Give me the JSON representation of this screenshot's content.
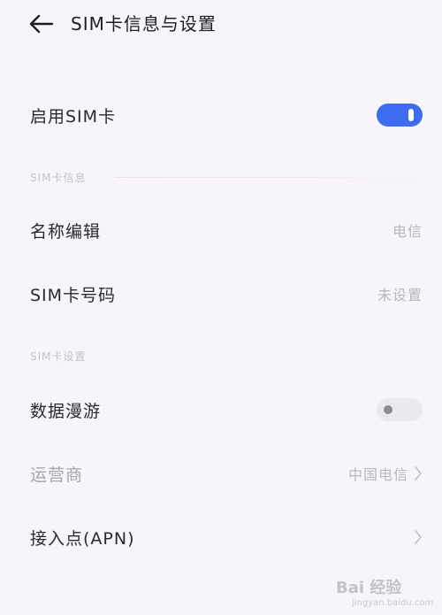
{
  "header": {
    "title": "SIM卡信息与设置"
  },
  "enable_sim": {
    "label": "启用SIM卡",
    "enabled": true
  },
  "section_info": {
    "label": "SIM卡信息"
  },
  "name_edit": {
    "label": "名称编辑",
    "value": "电信"
  },
  "sim_number": {
    "label": "SIM卡号码",
    "value": "未设置"
  },
  "section_settings": {
    "label": "SIM卡设置"
  },
  "data_roaming": {
    "label": "数据漫游",
    "enabled": false
  },
  "carrier": {
    "label": "运营商",
    "value": "中国电信"
  },
  "apn": {
    "label": "接入点(APN)"
  },
  "watermark": {
    "text": "Bai 经验",
    "sub": "jingyan.baidu.com"
  },
  "colors": {
    "accent": "#3e6cf1",
    "background": "#f7f5fa"
  }
}
